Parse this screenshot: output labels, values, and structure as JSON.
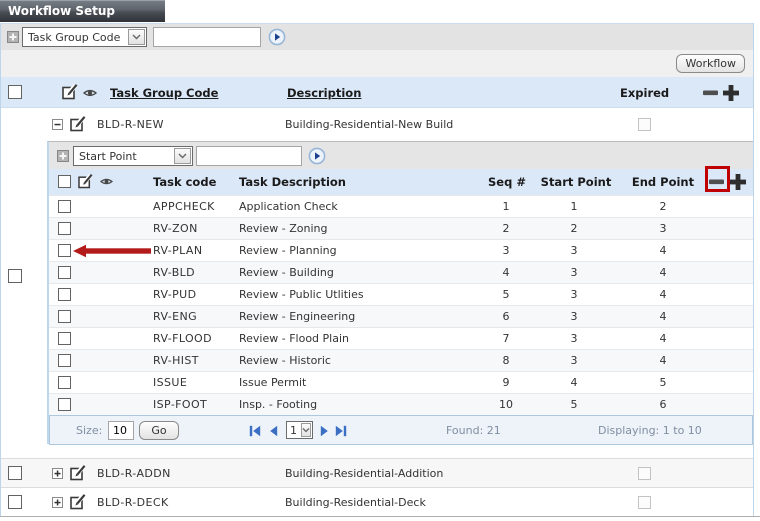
{
  "title": "Workflow Setup",
  "toolbar": {
    "workflow_button": "Workflow"
  },
  "outer_search": {
    "selected_option": "Task Group Code",
    "input_value": ""
  },
  "outer_table": {
    "headers": {
      "group_code": "Task Group Code",
      "description": "Description",
      "expired": "Expired"
    },
    "rows": [
      {
        "code": "BLD-R-NEW",
        "description": "Building-Residential-New Build",
        "expired": false,
        "expanded": true
      },
      {
        "code": "BLD-R-ADDN",
        "description": "Building-Residential-Addition",
        "expired": false,
        "expanded": false
      },
      {
        "code": "BLD-R-DECK",
        "description": "Building-Residential-Deck",
        "expired": false,
        "expanded": false
      }
    ]
  },
  "nested_search": {
    "selected_option": "Start Point",
    "input_value": ""
  },
  "nested_table": {
    "headers": {
      "task_code": "Task code",
      "task_description": "Task Description",
      "seq": "Seq #",
      "start_point": "Start Point",
      "end_point": "End Point"
    },
    "rows": [
      {
        "task_code": "APPCHECK",
        "description": "Application Check",
        "seq": "1",
        "start": "1",
        "end": "2"
      },
      {
        "task_code": "RV-ZON",
        "description": "Review - Zoning",
        "seq": "2",
        "start": "2",
        "end": "3"
      },
      {
        "task_code": "RV-PLAN",
        "description": "Review - Planning",
        "seq": "3",
        "start": "3",
        "end": "4"
      },
      {
        "task_code": "RV-BLD",
        "description": "Review - Building",
        "seq": "4",
        "start": "3",
        "end": "4"
      },
      {
        "task_code": "RV-PUD",
        "description": "Review - Public Utlities",
        "seq": "5",
        "start": "3",
        "end": "4"
      },
      {
        "task_code": "RV-ENG",
        "description": "Review - Engineering",
        "seq": "6",
        "start": "3",
        "end": "4"
      },
      {
        "task_code": "RV-FLOOD",
        "description": "Review - Flood Plain",
        "seq": "7",
        "start": "3",
        "end": "4"
      },
      {
        "task_code": "RV-HIST",
        "description": "Review - Historic",
        "seq": "8",
        "start": "3",
        "end": "4"
      },
      {
        "task_code": "ISSUE",
        "description": "Issue Permit",
        "seq": "9",
        "start": "4",
        "end": "5"
      },
      {
        "task_code": "ISP-FOOT",
        "description": "Insp. - Footing",
        "seq": "10",
        "start": "5",
        "end": "6"
      }
    ],
    "pager": {
      "size_label": "Size:",
      "size_value": "10",
      "go_label": "Go",
      "page_value": "1",
      "found_label": "Found: 21",
      "displaying_label": "Displaying: 1 to 10"
    }
  },
  "annotations": {
    "arrow_row_task_code": "RV-PLAN",
    "arrow_row_index": 2,
    "arrow_color": "#b31b1b",
    "highlight_box_color": "#c00000"
  }
}
